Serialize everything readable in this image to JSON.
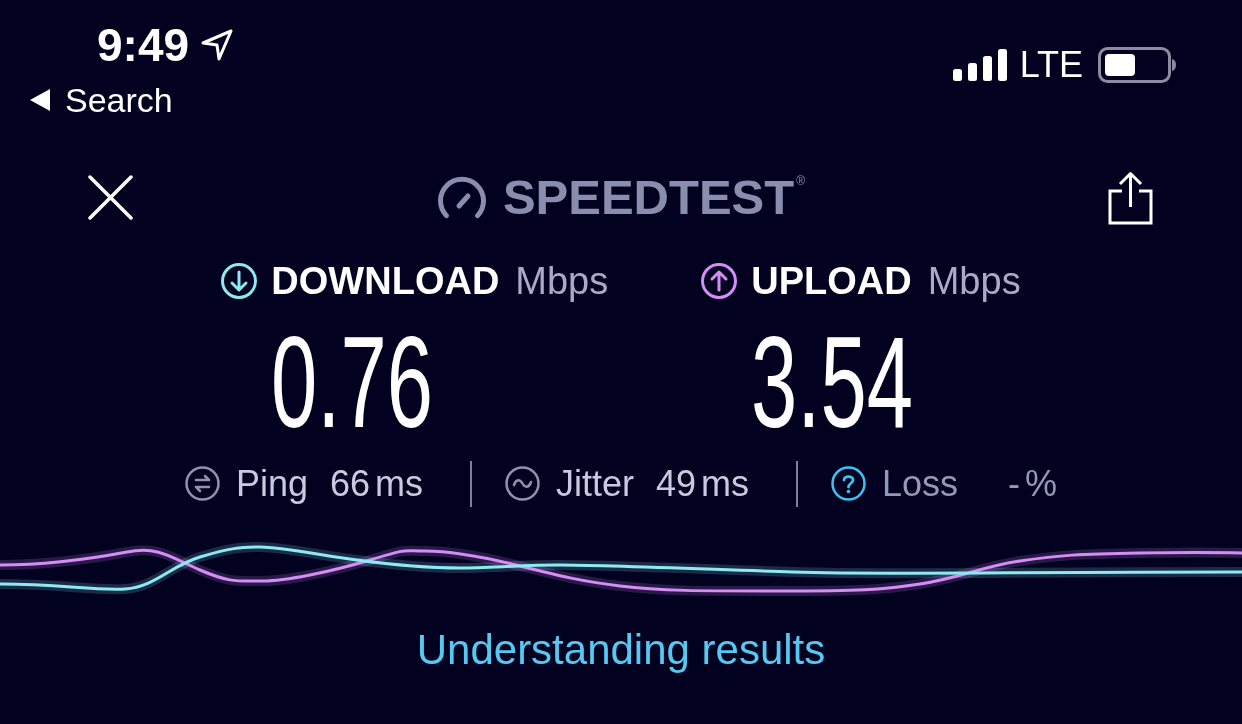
{
  "status_bar": {
    "time": "9:49",
    "back_label": "Search",
    "network": "LTE"
  },
  "header": {
    "logo_text": "SPEEDTEST",
    "trademark": "®"
  },
  "results": [
    {
      "kind": "download",
      "label": "DOWNLOAD",
      "unit": "Mbps",
      "value": "0.76",
      "color": "#8eeaf2"
    },
    {
      "kind": "upload",
      "label": "UPLOAD",
      "unit": "Mbps",
      "value": "3.54",
      "color": "#d68cf6"
    }
  ],
  "metrics": [
    {
      "kind": "ping",
      "label": "Ping",
      "value": "66",
      "unit": "ms",
      "available": true
    },
    {
      "kind": "jitter",
      "label": "Jitter",
      "value": "49",
      "unit": "ms",
      "available": true
    },
    {
      "kind": "loss",
      "label": "Loss",
      "value": "-",
      "unit": "%",
      "available": false
    }
  ],
  "link": "Understanding results"
}
